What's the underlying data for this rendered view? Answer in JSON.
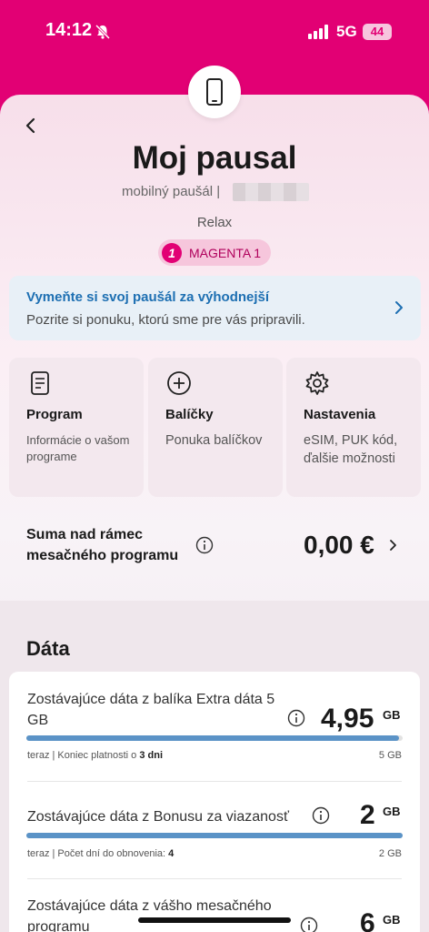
{
  "status": {
    "time": "14:12",
    "network": "5G",
    "battery": "44"
  },
  "header": {
    "title": "Moj pausal",
    "subtitle": "mobilný paušál |",
    "plan_name": "Relax",
    "badge_number": "1",
    "badge_label": "MAGENTA 1"
  },
  "promo": {
    "title": "Vymeňte si svoj paušál za výhodnejší",
    "subtitle": "Pozrite si ponuku, ktorú sme pre vás pripravili."
  },
  "cards": [
    {
      "title": "Program",
      "desc": "Informácie o vašom programe",
      "icon": "document-icon"
    },
    {
      "title": "Balíčky",
      "desc": "Ponuka balíčkov",
      "icon": "plus-circle-icon"
    },
    {
      "title": "Nastavenia",
      "desc": "eSIM, PUK kód, ďalšie možnosti",
      "icon": "gear-icon"
    }
  ],
  "overage": {
    "label": "Suma nad rámec mesačného programu",
    "amount": "0,00 €"
  },
  "data": {
    "heading": "Dáta",
    "rows": [
      {
        "label": "Zostávajúce dáta z balíka Extra dáta 5 GB",
        "value": "4,95",
        "unit": "GB",
        "fill_percent": 99,
        "meta_prefix": "teraz | Koniec platnosti o",
        "meta_bold": "3 dni",
        "total": "5 GB"
      },
      {
        "label": "Zostávajúce dáta z Bonusu za viazanosť",
        "value": "2",
        "unit": "GB",
        "fill_percent": 100,
        "meta_prefix": "teraz | Počet dní do obnovenia:",
        "meta_bold": "4",
        "total": "2 GB"
      },
      {
        "label": "Zostávajúce dáta z vášho mesačného programu",
        "value": "6",
        "unit": "GB"
      }
    ]
  },
  "colors": {
    "brand": "#e20074",
    "link": "#1d6fb2",
    "bar": "#5b93c7"
  }
}
